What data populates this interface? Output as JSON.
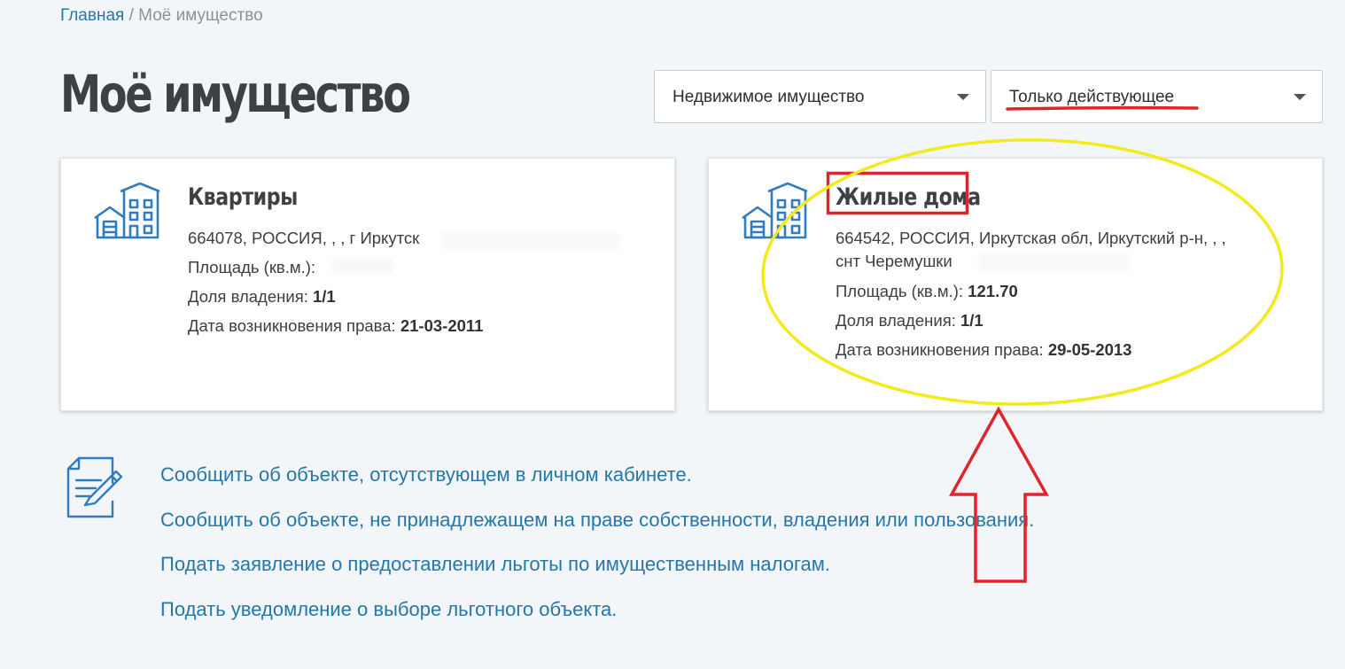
{
  "breadcrumb": {
    "home": "Главная",
    "separator": "/",
    "current": "Моё имущество"
  },
  "page_title": "Моё имущество",
  "filters": {
    "property_type": "Недвижимое имущество",
    "status": "Только действующее"
  },
  "cards": [
    {
      "title": "Квартиры",
      "address": "664078, РОССИЯ, , , г Иркутск",
      "address_line2": "",
      "area_label": "Площадь (кв.м.):",
      "area_value": "",
      "share_label": "Доля владения:",
      "share_value": "1/1",
      "date_label": "Дата возникновения права:",
      "date_value": "21-03-2011"
    },
    {
      "title": "Жилые дома",
      "address": "664542, РОССИЯ, Иркутская обл, Иркутский р-н, , ,",
      "address_line2": "снт Черемушки",
      "area_label": "Площадь (кв.м.):",
      "area_value": "121.70",
      "share_label": "Доля владения:",
      "share_value": "1/1",
      "date_label": "Дата возникновения права:",
      "date_value": "29-05-2013"
    }
  ],
  "links": [
    "Сообщить об объекте, отсутствующем в личном кабинете.",
    "Сообщить об объекте, не принадлежащем на праве собственности, владения или пользования.",
    "Подать заявление о предоставлении льготы по имущественным налогам.",
    "Подать уведомление о выборе льготного объекта."
  ],
  "colors": {
    "link": "#2576aa",
    "icon": "#2f7cc1",
    "annotation_red": "#e0242c",
    "annotation_yellow": "#f2ea1c"
  },
  "icons": {
    "card_icon": "house-icon",
    "links_icon": "document-edit-icon",
    "select_caret": "caret-down-icon"
  }
}
